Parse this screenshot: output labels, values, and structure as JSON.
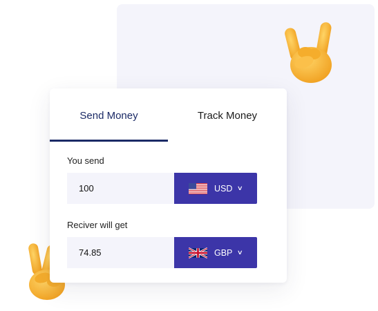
{
  "tabs": [
    {
      "label": "Send Money",
      "active": true
    },
    {
      "label": "Track Money",
      "active": false
    }
  ],
  "send": {
    "label": "You send",
    "amount": "100",
    "currency": "USD",
    "flag_icon": "us-flag-icon"
  },
  "receive": {
    "label": "Reciver will get",
    "amount": "74.85",
    "currency": "GBP",
    "flag_icon": "uk-flag-icon"
  },
  "colors": {
    "accent": "#3c35a8",
    "tab_active": "#1b2a66",
    "input_bg": "#f4f4fb",
    "emoji_skin": "#f7b53a"
  },
  "decorations": [
    "rock-hand-emoji-icon",
    "peace-hand-emoji-icon"
  ]
}
